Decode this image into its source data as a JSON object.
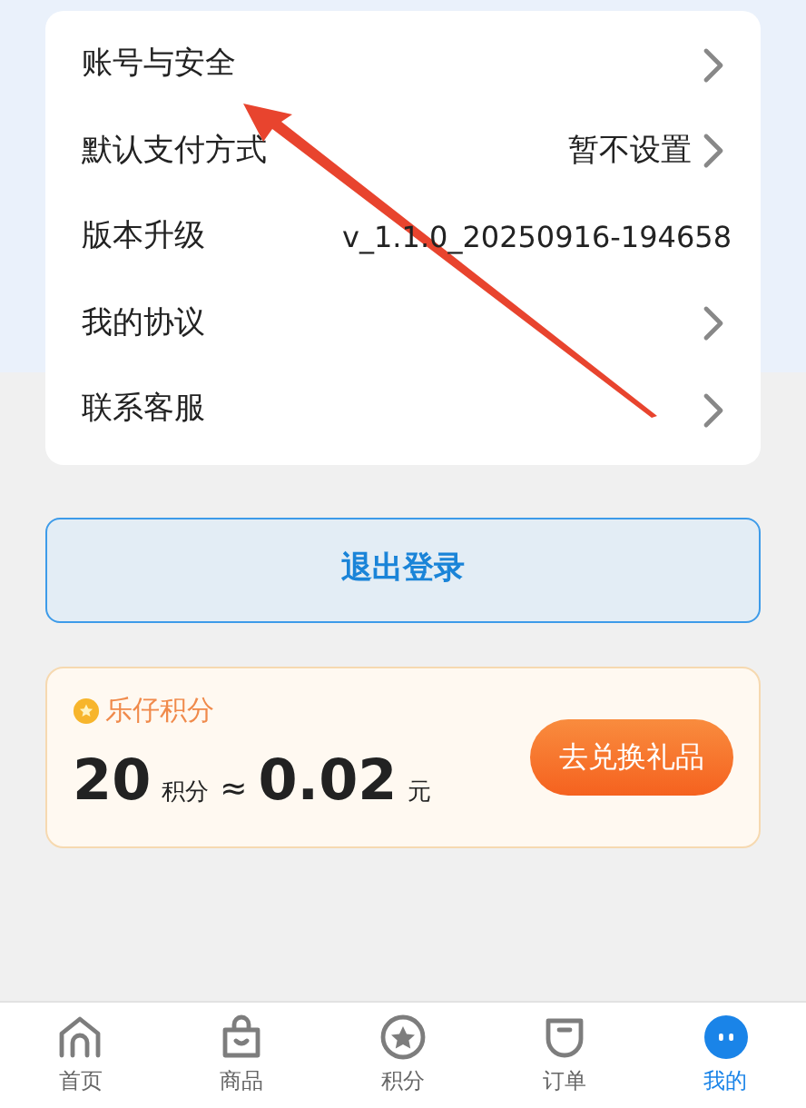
{
  "menu": [
    {
      "label": "账号与安全",
      "chevron": true
    },
    {
      "label": "默认支付方式",
      "value": "暂不设置",
      "chevron": true
    },
    {
      "label": "版本升级",
      "value": "v_1.1.0_20250916-194658",
      "chevron": false
    },
    {
      "label": "我的协议",
      "chevron": true
    },
    {
      "label": "联系客服",
      "chevron": true
    }
  ],
  "logout": {
    "label": "退出登录"
  },
  "points": {
    "title": "乐仔积分",
    "amount": "20",
    "unit": "积分",
    "approx": "≈",
    "money": "0.02",
    "currency": "元",
    "button": "去兑换礼品"
  },
  "nav": [
    {
      "kind": "home",
      "label": "首页",
      "selected": false
    },
    {
      "kind": "bag",
      "label": "商品",
      "selected": false
    },
    {
      "kind": "star",
      "label": "积分",
      "selected": false
    },
    {
      "kind": "order",
      "label": "订单",
      "selected": false
    },
    {
      "kind": "me",
      "label": "我的",
      "selected": true
    }
  ]
}
